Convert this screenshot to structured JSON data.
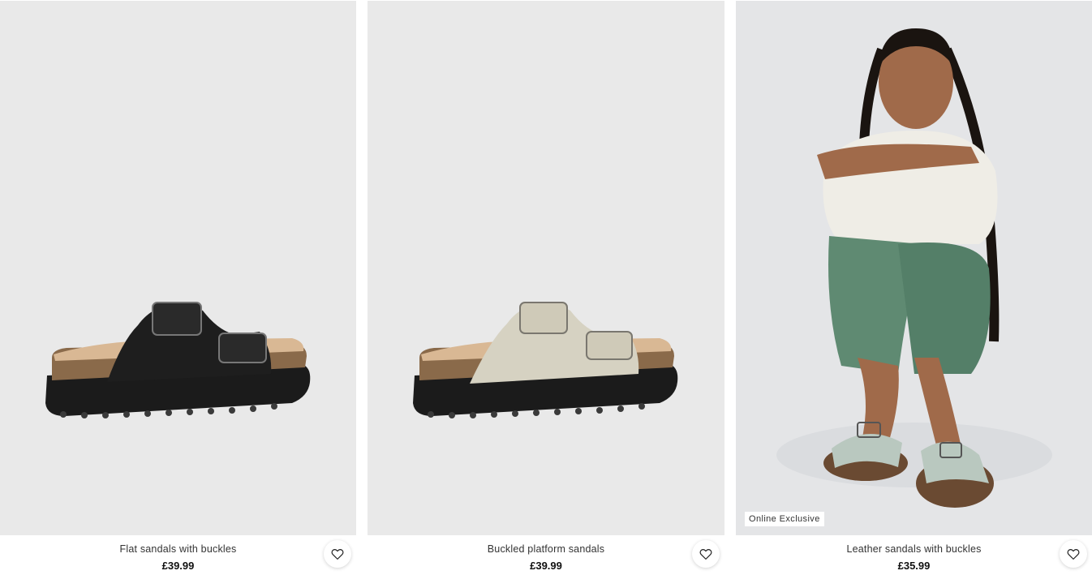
{
  "products": [
    {
      "name": "Flat sandals with buckles",
      "price": "£39.99",
      "image_icon": "black-platform-sandal-image",
      "badge": ""
    },
    {
      "name": "Buckled platform sandals",
      "price": "£39.99",
      "image_icon": "beige-platform-sandal-image",
      "badge": ""
    },
    {
      "name": "Leather sandals with buckles",
      "price": "£35.99",
      "image_icon": "model-wearing-sandals-image",
      "badge": "Online Exclusive"
    }
  ],
  "colors": {
    "image_background": "#e9e9e9",
    "upper_black": "#1e1e1e",
    "upper_beige": "#d6d2c2",
    "upper_mint": "#b9c8bf",
    "cork": "#8a6a4a",
    "sole": "#1b1b1b"
  }
}
